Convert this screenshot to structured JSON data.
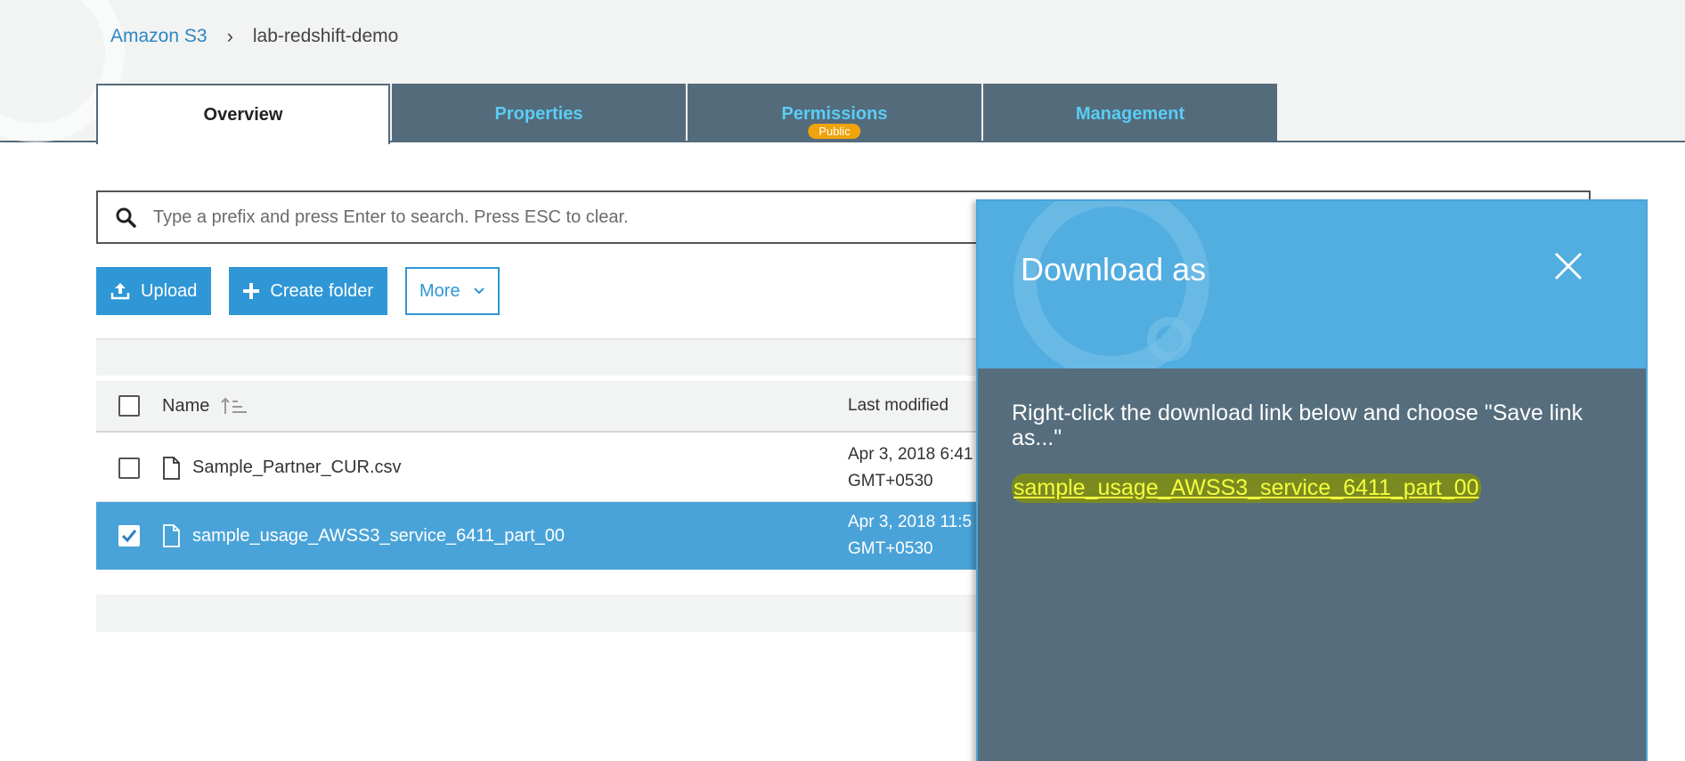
{
  "breadcrumb": {
    "root": "Amazon S3",
    "separator": "›",
    "current": "lab-redshift-demo"
  },
  "tabs": [
    {
      "label": "Overview",
      "active": true
    },
    {
      "label": "Properties",
      "active": false
    },
    {
      "label": "Permissions",
      "active": false,
      "badge": "Public"
    },
    {
      "label": "Management",
      "active": false
    }
  ],
  "search": {
    "placeholder": "Type a prefix and press Enter to search. Press ESC to clear.",
    "icon": "search-icon"
  },
  "actions": {
    "upload_label": "Upload",
    "create_folder_label": "Create folder",
    "more_label": "More"
  },
  "table": {
    "columns": {
      "name": "Name",
      "last_modified": "Last modified"
    },
    "rows": [
      {
        "name": "Sample_Partner_CUR.csv",
        "modified_line1": "Apr 3, 2018 6:41",
        "modified_line2": "GMT+0530",
        "selected": false
      },
      {
        "name": "sample_usage_AWSS3_service_6411_part_00",
        "modified_line1": "Apr 3, 2018 11:5",
        "modified_line2": "GMT+0530",
        "selected": true
      }
    ]
  },
  "modal": {
    "title": "Download as",
    "instructions": "Right-click the download link below and choose \"Save link as...\"",
    "link_text": "sample_usage_AWSS3_service_6411_part_00"
  },
  "colors": {
    "accent": "#2f97d6",
    "tab_dark": "#546b7b",
    "tab_text": "#59cdf5",
    "badge": "#f0a30a",
    "selected_row": "#4aa3d8",
    "modal_body": "#556d7c",
    "modal_header": "#52ade0",
    "link_highlight": "#f3ff3c"
  }
}
